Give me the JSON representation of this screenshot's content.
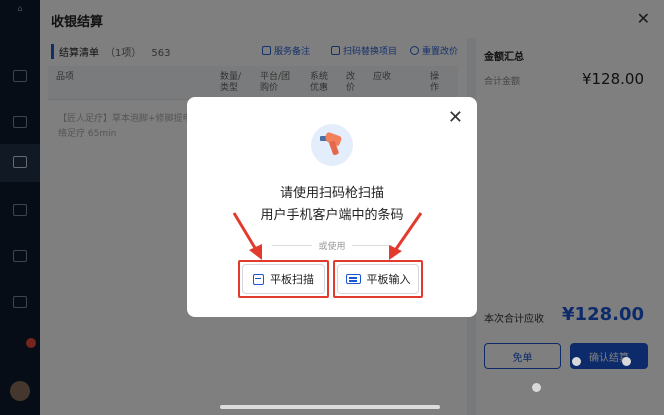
{
  "panel": {
    "title": "收银结算",
    "close_glyph": "✕"
  },
  "list": {
    "title": "结算清单",
    "count": "（1项）",
    "order_id": "563",
    "tools": {
      "service_note": "服务备注",
      "scan_replace": "扫码替换项目",
      "reset_price": "重置改价"
    },
    "columns": [
      "品项",
      "数量/类型",
      "平台/团购价",
      "系统优惠",
      "改价",
      "应收",
      "操作"
    ],
    "row_text": "【匠人足疗】草本泡脚+修脚提甲+颈肩按摩+经络足疗 65min"
  },
  "summary": {
    "title": "金额汇总",
    "total_label": "合计金额",
    "total_value": "¥128.00",
    "due_label": "本次合计应收",
    "due_value": "¥128.00",
    "free_button": "免单",
    "confirm_button": "确认结算"
  },
  "modal": {
    "line1": "请使用扫码枪扫描",
    "line2": "用户手机客户端中的条码",
    "or_text": "或使用",
    "tablet_scan": "平板扫描",
    "tablet_input": "平板输入",
    "close_glyph": "✕"
  },
  "colors": {
    "accent": "#1a56d6",
    "highlight": "#e23b2e"
  }
}
